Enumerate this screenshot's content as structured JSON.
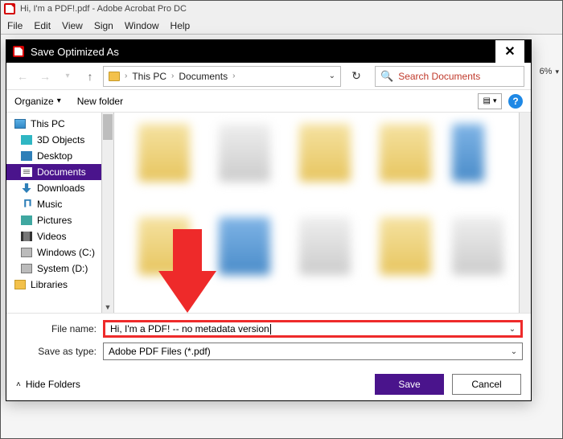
{
  "app": {
    "title": "Hi, I'm a PDF!.pdf - Adobe Acrobat Pro DC",
    "zoom": "6%"
  },
  "menu": [
    "File",
    "Edit",
    "View",
    "Sign",
    "Window",
    "Help"
  ],
  "dialog": {
    "title": "Save Optimized As",
    "breadcrumb": {
      "root": "This PC",
      "folder": "Documents"
    },
    "search_placeholder": "Search Documents",
    "organize_label": "Organize",
    "newfolder_label": "New folder",
    "tree": [
      {
        "label": "This PC",
        "icon": "pc",
        "lvl": 0
      },
      {
        "label": "3D Objects",
        "icon": "3d",
        "lvl": 1
      },
      {
        "label": "Desktop",
        "icon": "desktop",
        "lvl": 1
      },
      {
        "label": "Documents",
        "icon": "doc",
        "lvl": 1,
        "selected": true
      },
      {
        "label": "Downloads",
        "icon": "dl",
        "lvl": 1
      },
      {
        "label": "Music",
        "icon": "music",
        "lvl": 1
      },
      {
        "label": "Pictures",
        "icon": "pic",
        "lvl": 1
      },
      {
        "label": "Videos",
        "icon": "vid",
        "lvl": 1
      },
      {
        "label": "Windows (C:)",
        "icon": "drive",
        "lvl": 1
      },
      {
        "label": "System (D:)",
        "icon": "drive",
        "lvl": 1
      },
      {
        "label": "Libraries",
        "icon": "lib",
        "lvl": 0
      }
    ],
    "filename_label": "File name:",
    "filename_value": "Hi, I'm a PDF! -- no metadata version",
    "filetype_label": "Save as type:",
    "filetype_value": "Adobe PDF Files (*.pdf)",
    "hide_folders_label": "Hide Folders",
    "save_label": "Save",
    "cancel_label": "Cancel"
  }
}
